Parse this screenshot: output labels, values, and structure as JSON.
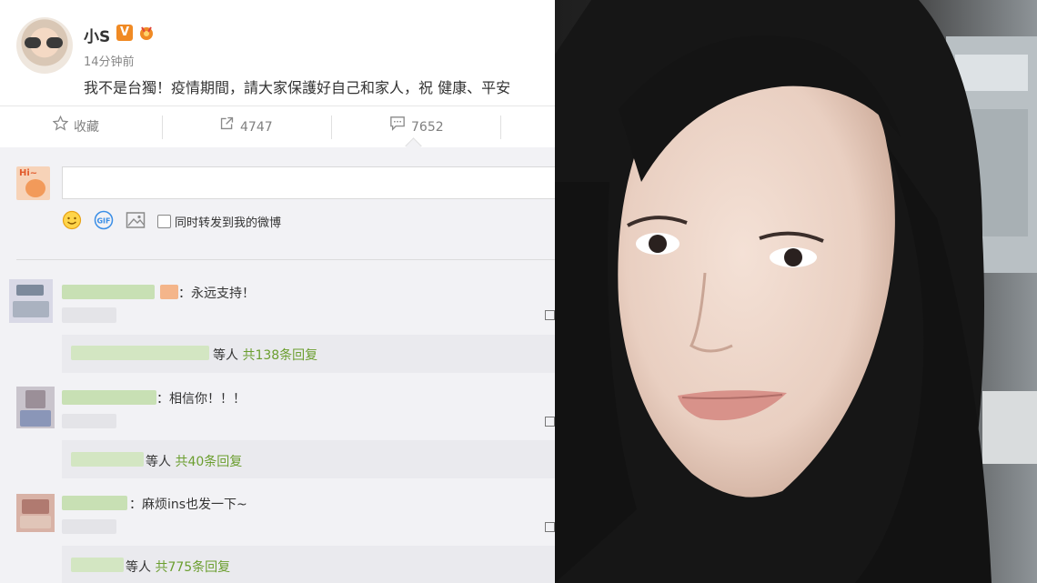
{
  "post": {
    "author": "小S",
    "verified_badge": "V",
    "time": "14分钟前",
    "text": "我不是台獨！疫情期間，請大家保護好自己和家人，祝  健康、平安"
  },
  "actions": {
    "favorite": "收藏",
    "repost_count": "4747",
    "comment_count": "7652"
  },
  "composer": {
    "input_value": "",
    "avatar_text": "Hi~",
    "sync_label": "同时转发到我的微博"
  },
  "comments": [
    {
      "text": "：永远支持！",
      "reply_who": "等人",
      "reply_count": "共138条回复"
    },
    {
      "text": "：相信你！！！",
      "reply_who": "等人",
      "reply_count": "共40条回复"
    },
    {
      "text": "：麻烦ins也发一下~",
      "reply_who": "等人",
      "reply_count": "共775条回复"
    }
  ],
  "colors": {
    "accent_orange": "#f08a24",
    "reply_green": "#6b9e2f",
    "comment_bg": "#f2f2f5",
    "gif_blue": "#3a8ee6"
  },
  "icons": [
    "star-icon",
    "repost-icon",
    "comment-icon",
    "smile-icon",
    "gif-icon",
    "image-icon",
    "qr-icon"
  ]
}
